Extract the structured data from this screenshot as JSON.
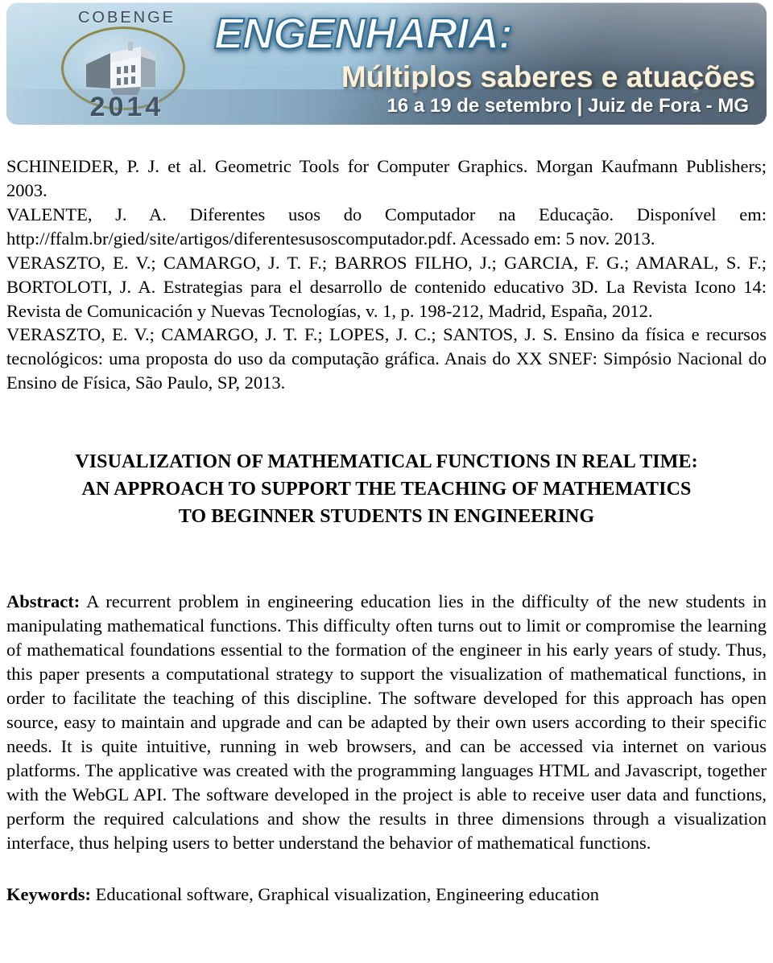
{
  "banner": {
    "logo_word": "COBENGE",
    "logo_year": "2014",
    "logo_seal_icon": "building-seal-icon",
    "title": "ENGENHARIA:",
    "subtitle": "Múltiplos saberes e atuações",
    "date_location": "16 a 19 de setembro | Juiz de Fora - MG",
    "colors": {
      "light_blue": "#a8cade",
      "dark_slate": "#5c7388",
      "title_white": "#ffffff",
      "title_outline": "#2d6f96",
      "subtitle_cream": "#f7f1dd",
      "seal_gold": "#8f8a4c"
    }
  },
  "references": {
    "lines": [
      "SCHINEIDER, P. J. et al. Geometric Tools for Computer Graphics. Morgan Kaufmann Publishers; 2003.",
      "VALENTE, J. A. Diferentes usos do Computador na Educação. Disponível em: http://ffalm.br/gied/site/artigos/diferentesusoscomputador.pdf. Acessado em: 5 nov. 2013.",
      "VERASZTO, E. V.; CAMARGO, J. T. F.; BARROS FILHO, J.; GARCIA, F. G.; AMARAL, S. F.; BORTOLOTI, J. A. Estrategias para el desarrollo de contenido educativo 3D. La Revista Icono 14: Revista de Comunicación y Nuevas Tecnologías, v. 1, p. 198-212, Madrid, España, 2012.",
      "VERASZTO, E. V.; CAMARGO, J. T. F.; LOPES, J. C.; SANTOS, J. S. Ensino da física e recursos tecnológicos: uma proposta do uso da computação gráfica. Anais do XX SNEF: Simpósio Nacional do Ensino de Física, São Paulo, SP, 2013."
    ]
  },
  "paper": {
    "title_lines": [
      "VISUALIZATION OF MATHEMATICAL FUNCTIONS IN REAL TIME:",
      "AN APPROACH TO SUPPORT THE TEACHING OF MATHEMATICS",
      "TO BEGINNER STUDENTS IN ENGINEERING"
    ],
    "abstract_label": "Abstract:",
    "abstract_text": "A recurrent problem in engineering education lies in the difficulty of the new students in manipulating mathematical functions. This difficulty often turns out to limit or compromise the learning of mathematical foundations essential to the formation of the engineer in his early years of study. Thus, this paper presents a computational strategy to support the visualization of mathematical functions, in order to facilitate the teaching of this discipline. The software developed for this approach has open source, easy to maintain and upgrade and can be adapted by their own users according to their specific needs. It is quite intuitive, running in web browsers, and can be accessed via internet on various platforms. The applicative was created with the programming languages HTML and Javascript, together with the WebGL API. The software developed in the project is able to receive user data and functions, perform the required calculations and show the results in three dimensions through a visualization interface, thus helping users to better understand the behavior of mathematical functions.",
    "keywords_label": "Keywords:",
    "keywords_text": "Educational software, Graphical visualization, Engineering education"
  }
}
